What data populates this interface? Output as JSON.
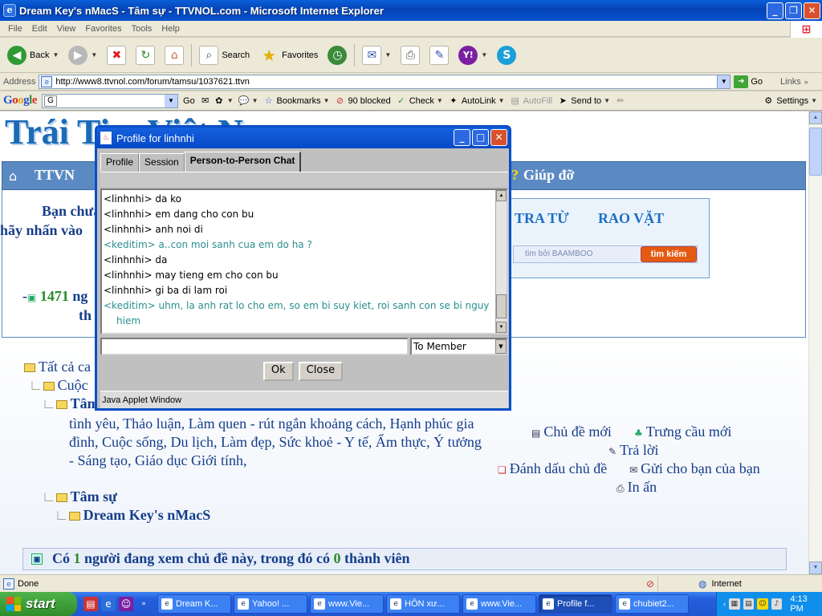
{
  "window": {
    "title": "Dream Key's nMacS - Tâm sự - TTVNOL.com - Microsoft Internet Explorer"
  },
  "menu": [
    "File",
    "Edit",
    "View",
    "Favorites",
    "Tools",
    "Help"
  ],
  "toolbar": {
    "back": "Back",
    "search": "Search",
    "favorites": "Favorites"
  },
  "address": {
    "label": "Address",
    "url": "http://www8.ttvnol.com/forum/tamsu/1037621.ttvn",
    "go": "Go",
    "links": "Links"
  },
  "googlebar": {
    "go": "Go",
    "bookmarks": "Bookmarks",
    "blocked": "90 blocked",
    "check": "Check",
    "autolink": "AutoLink",
    "autofill": "AutoFill",
    "sendto": "Send to",
    "settings": "Settings"
  },
  "page": {
    "site_title": "Trái Tim Việt Nam",
    "nav_home": "TTVN",
    "nav_help": "Giúp đỡ",
    "greeting_1": "Bạn chưa",
    "greeting_2": "hãy nhấn vào",
    "tratu": "TRA TỪ",
    "raovat": "RAO VẶT",
    "baambo": "tìm bởi BAAMBOO",
    "timkiem": "tìm kiếm",
    "stat_count": "1471",
    "stat_suffix": "ng",
    "stat_line2": "th",
    "tree_all": "Tất cả ca",
    "tree_cuoc": "Cuộc",
    "tree_tam": "Tâm",
    "desc": "tình yêu, Thảo luận, Làm quen - rút ngắn khoảng cách, Hạnh phúc gia đình, Cuộc sống, Du lịch, Làm đẹp, Sức khoẻ - Y tế, Ẩm thực, Ý tưởng - Sáng tạo, Giáo dục Giới tính,",
    "tree_tamsu": "Tâm sự",
    "tree_thread": "Dream Key's nMacS",
    "link_new_topic": "Chủ đề mới",
    "link_new_poll": "Trưng cầu mới",
    "link_reply": "Trả lời",
    "link_mark": "Đánh dấu chủ đề",
    "link_send": "Gửi cho bạn của bạn",
    "link_print": "In ấn",
    "viewers_pre": "Có",
    "viewers_n": "1",
    "viewers_mid": "người đang xem chủ đề này, trong đó có",
    "viewers_members": "0",
    "viewers_post": "thành viên"
  },
  "dialog": {
    "title": "Profile for linhnhi",
    "tabs": [
      "Profile",
      "Session",
      "Person-to-Person Chat"
    ],
    "chat": [
      {
        "who": "<linhnhi>",
        "text": "da ko",
        "me": false
      },
      {
        "who": "<linhnhi>",
        "text": "em dang cho con bu",
        "me": false
      },
      {
        "who": "<linhnhi>",
        "text": "anh noi di",
        "me": false
      },
      {
        "who": "<keditim>",
        "text": "a..con moi sanh cua em do ha ?",
        "me": true
      },
      {
        "who": "<linhnhi>",
        "text": "da",
        "me": false
      },
      {
        "who": "<linhnhi>",
        "text": "may tieng em cho con bu",
        "me": false
      },
      {
        "who": "<linhnhi>",
        "text": "gi ba di lam roi",
        "me": false
      },
      {
        "who": "<keditim>",
        "text": "uhm, la anh rat lo cho em, so em bi suy kiet, roi sanh con se bi nguy",
        "me": true,
        "cont": "hiem"
      }
    ],
    "recipient": "To Member",
    "ok": "Ok",
    "close": "Close",
    "applet_label": "Java Applet Window"
  },
  "status": {
    "text": "Done",
    "zone": "Internet"
  },
  "taskbar": {
    "start": "start",
    "tasks": [
      "Dream K...",
      "Yahoo! ...",
      "www.Vie...",
      "HÔN xư...",
      "www.Vie...",
      "Profile f...",
      "chubiet2..."
    ],
    "active_index": 5,
    "clock": "4:13 PM"
  }
}
